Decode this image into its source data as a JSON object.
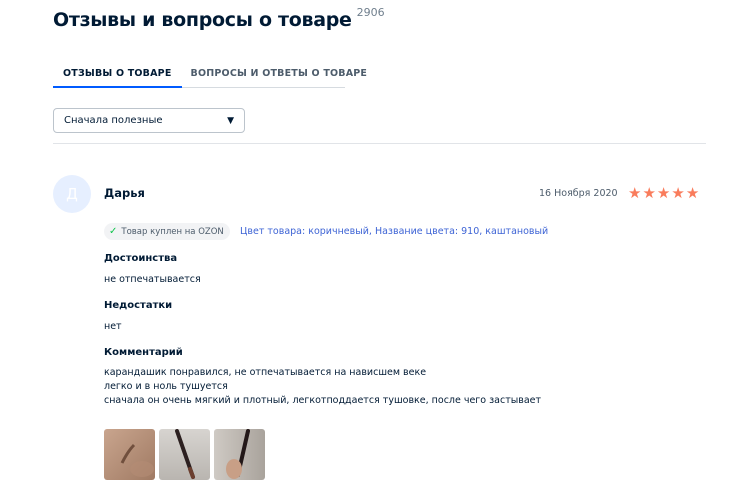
{
  "header": {
    "title": "Отзывы и вопросы о товаре",
    "count": "2906"
  },
  "tabs": [
    {
      "label": "ОТЗЫВЫ О ТОВАРЕ",
      "active": true
    },
    {
      "label": "ВОПРОСЫ И ОТВЕТЫ О ТОВАРЕ",
      "active": false
    }
  ],
  "sort": {
    "selected": "Сначала полезные"
  },
  "review": {
    "avatar_letter": "Д",
    "author": "Дарья",
    "date": "16 Ноября 2020",
    "rating": 5,
    "verified_label": "Товар куплен на OZON",
    "attributes": "Цвет товара: коричневый, Название цвета: 910, каштановый",
    "pros_title": "Достоинства",
    "pros_text": "не отпечатывается",
    "cons_title": "Недостатки",
    "cons_text": "нет",
    "comment_title": "Комментарий",
    "comment_lines": [
      "карандашик понравился, не отпечатывается на нависшем веке",
      "легко и в ноль тушуется",
      "сначала он очень мягкий и плотный, легкотподдается тушовке, после чего застывает"
    ]
  },
  "colors": {
    "accent": "#005bff",
    "star": "#f97c5c",
    "link": "#3e64d5",
    "check": "#10c44c"
  },
  "icons": {
    "star": "star-icon",
    "check": "check-icon",
    "dropdown": "triangle-down-icon"
  }
}
